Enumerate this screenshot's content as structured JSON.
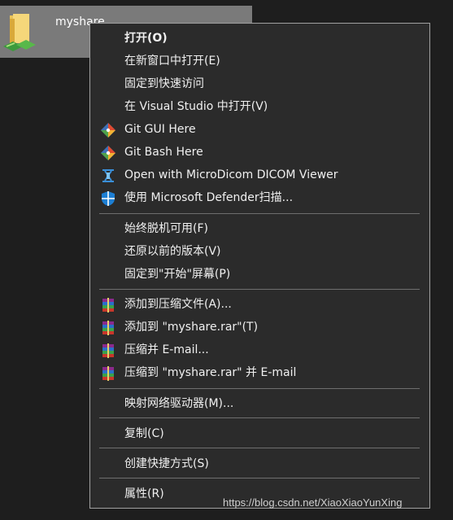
{
  "folder": {
    "name": "myshare"
  },
  "menu": {
    "items": [
      {
        "label": "打开(O)"
      },
      {
        "label": "在新窗口中打开(E)"
      },
      {
        "label": "固定到快速访问"
      },
      {
        "label": "在 Visual Studio 中打开(V)"
      },
      {
        "label": "Git GUI Here"
      },
      {
        "label": "Git Bash Here"
      },
      {
        "label": "Open with MicroDicom DICOM Viewer"
      },
      {
        "label": "使用 Microsoft Defender扫描..."
      },
      {
        "label": "始终脱机可用(F)"
      },
      {
        "label": "还原以前的版本(V)"
      },
      {
        "label": "固定到\"开始\"屏幕(P)"
      },
      {
        "label": "添加到压缩文件(A)..."
      },
      {
        "label": "添加到 \"myshare.rar\"(T)"
      },
      {
        "label": "压缩并 E-mail..."
      },
      {
        "label": "压缩到 \"myshare.rar\" 并 E-mail"
      },
      {
        "label": "映射网络驱动器(M)..."
      },
      {
        "label": "复制(C)"
      },
      {
        "label": "创建快捷方式(S)"
      },
      {
        "label": "属性(R)"
      }
    ]
  },
  "icons": {
    "folder": "folder-shared-icon",
    "git": "git-icon",
    "dicom": "microdicom-icon",
    "defender": "defender-shield-icon",
    "winrar": "winrar-icon"
  },
  "watermark": "https://blog.csdn.net/XiaoXiaoYunXing"
}
